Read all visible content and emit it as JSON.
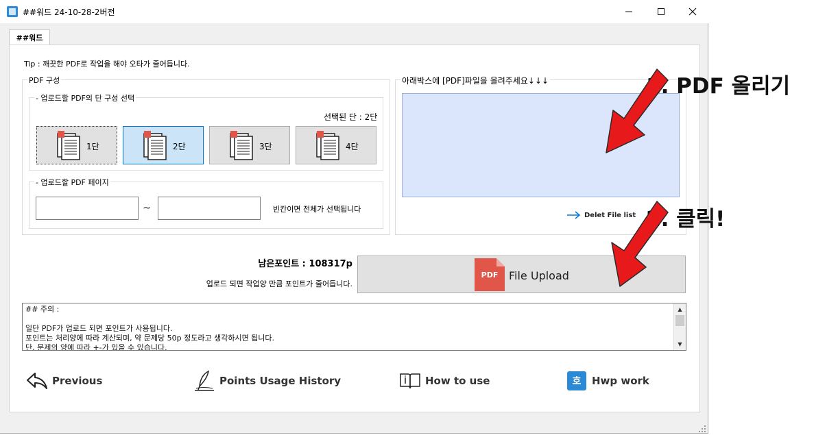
{
  "window": {
    "title": "##워드 24-10-28-2버전",
    "minimize_glyph": "—",
    "maximize_glyph": "☐",
    "close_glyph": "✕"
  },
  "tab": {
    "label": "##워드"
  },
  "tip": "Tip : 깨끗한 PDF로 작업을 해야 오타가 줄어듭니다.",
  "pdf_config": {
    "legend": "PDF 구성",
    "columns_group": {
      "legend": "- 업로드할 PDF의 단 구성 선택",
      "selected_label": "선택된 단 : 2단",
      "buttons": [
        {
          "label": "1단"
        },
        {
          "label": "2단"
        },
        {
          "label": "3단"
        },
        {
          "label": "4단"
        }
      ],
      "selected_index": 1
    },
    "pages_group": {
      "legend": "- 업로드할 PDF 페이지",
      "from_value": "",
      "to_value": "",
      "separator": "~",
      "hint": "빈칸이면 전체가 선택됩니다"
    }
  },
  "upload_area": {
    "legend": "아래박스에 [PDF]파일을 올려주세요↓↓↓",
    "delete_label": "Delet File list"
  },
  "points": {
    "remaining_label": "남은포인트 : 108317p",
    "note": "업로드 되면 작업양 만큼 포인트가 줄어듭니다."
  },
  "upload_button": {
    "badge": "PDF",
    "label": "File Upload"
  },
  "notes_text": "## 주의 :\n\n일단 PDF가 업로드 되면 포인트가 사용됩니다.\n포인트는 처리양에 따라 계산되며, 약 문제당 50p 정도라고 생각하시면 됩니다.\n단, 문제의 양에 따라 +-가 있을 수 있습니다.",
  "nav": {
    "previous": "Previous",
    "history": "Points Usage History",
    "how_to": "How to use",
    "hwp": "Hwp work",
    "hwp_icon_char": "호"
  },
  "annotations": {
    "step1": "1. PDF 올리기",
    "step2": "2. 클릭!"
  },
  "colors": {
    "arrow_red": "#e8191b",
    "accent_blue": "#0078d7",
    "dropzone": "#dbe6fd",
    "pdf_badge": "#e0574a"
  }
}
